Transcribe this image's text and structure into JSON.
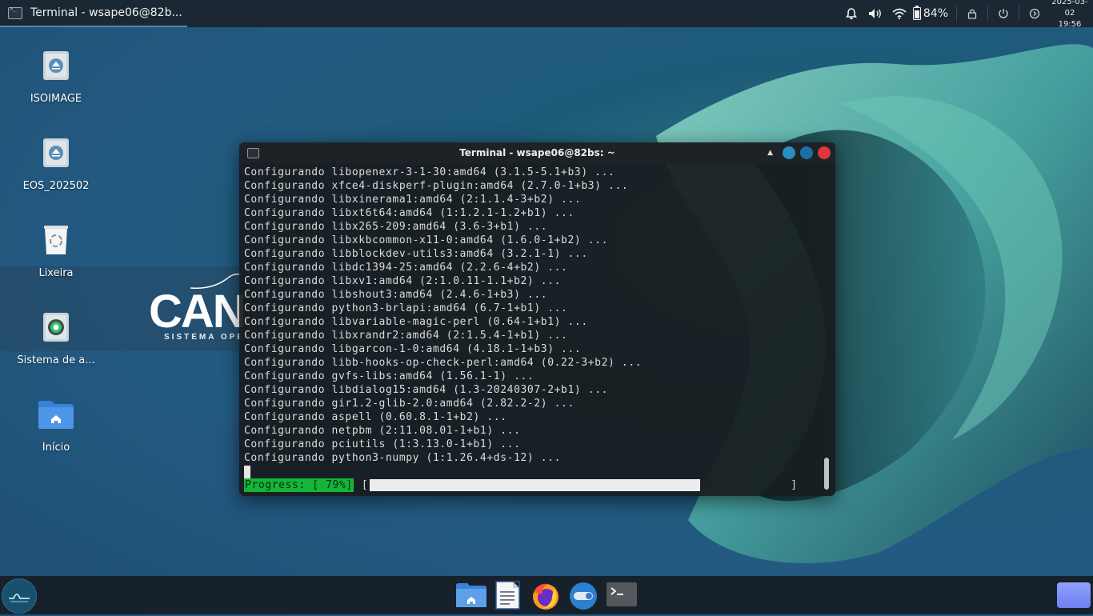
{
  "taskbar": {
    "active_window_title": "Terminal - wsape06@82b...",
    "battery_percent": "84%",
    "clock_date": "2025-03-02",
    "clock_time": "19:56"
  },
  "desktop_icons": [
    {
      "label": "ISOIMAGE",
      "icon": "eject-drive-icon"
    },
    {
      "label": "EOS_202502",
      "icon": "eject-drive-icon"
    },
    {
      "label": "Lixeira",
      "icon": "trash-icon"
    },
    {
      "label": "Sistema de a...",
      "icon": "system-update-icon"
    },
    {
      "label": "Início",
      "icon": "home-folder-icon"
    }
  ],
  "wallpaper_logo": {
    "text": "CAN",
    "subtitle": "SISTEMA OPE"
  },
  "terminal": {
    "title": "Terminal - wsape06@82bs: ~",
    "lines": [
      "Configurando libopenexr-3-1-30:amd64 (3.1.5-5.1+b3) ...",
      "Configurando xfce4-diskperf-plugin:amd64 (2.7.0-1+b3) ...",
      "Configurando libxinerama1:amd64 (2:1.1.4-3+b2) ...",
      "Configurando libxt6t64:amd64 (1:1.2.1-1.2+b1) ...",
      "Configurando libx265-209:amd64 (3.6-3+b1) ...",
      "Configurando libxkbcommon-x11-0:amd64 (1.6.0-1+b2) ...",
      "Configurando libblockdev-utils3:amd64 (3.2.1-1) ...",
      "Configurando libdc1394-25:amd64 (2.2.6-4+b2) ...",
      "Configurando libxv1:amd64 (2:1.0.11-1.1+b2) ...",
      "Configurando libshout3:amd64 (2.4.6-1+b3) ...",
      "Configurando python3-brlapi:amd64 (6.7-1+b1) ...",
      "Configurando libvariable-magic-perl (0.64-1+b1) ...",
      "Configurando libxrandr2:amd64 (2:1.5.4-1+b1) ...",
      "Configurando libgarcon-1-0:amd64 (4.18.1-1+b3) ...",
      "Configurando libb-hooks-op-check-perl:amd64 (0.22-3+b2) ...",
      "Configurando gvfs-libs:amd64 (1.56.1-1) ...",
      "Configurando libdialog15:amd64 (1.3-20240307-2+b1) ...",
      "Configurando gir1.2-glib-2.0:amd64 (2.82.2-2) ...",
      "Configurando aspell (0.60.8.1-1+b2) ...",
      "Configurando netpbm (2:11.08.01-1+b1) ...",
      "Configurando pciutils (1:3.13.0-1+b1) ...",
      "Configurando python3-numpy (1:1.26.4+ds-12) ..."
    ],
    "progress_label": "Progress: [ 79%]",
    "progress_open": "[",
    "progress_close": "]",
    "progress_fraction": 0.79
  },
  "dock": [
    {
      "icon": "file-manager-icon"
    },
    {
      "icon": "text-editor-icon"
    },
    {
      "icon": "firefox-icon"
    },
    {
      "icon": "settings-toggle-icon"
    },
    {
      "icon": "terminal-icon"
    }
  ],
  "colors": {
    "progress_label_bg": "#14b53a",
    "close_button": "#e0363c",
    "min_button": "#2a8fc0",
    "max_button": "#1b6fa8"
  }
}
